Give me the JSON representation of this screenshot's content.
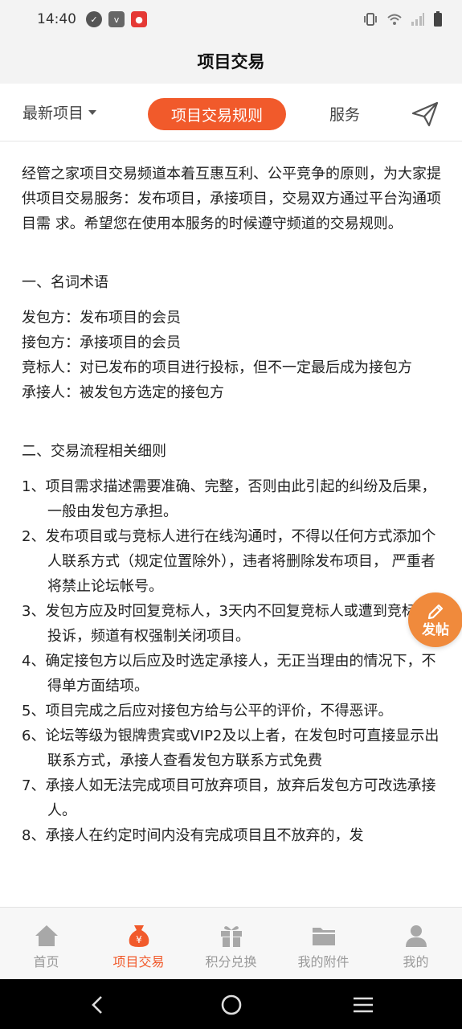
{
  "status_bar": {
    "time": "14:40",
    "left_icons": [
      "check-icon",
      "vivo-icon",
      "app-icon"
    ],
    "right_icons": [
      "vibrate-icon",
      "wifi-icon",
      "signal-icon",
      "battery-icon"
    ]
  },
  "header": {
    "title": "项目交易"
  },
  "tabs": {
    "latest": "最新项目",
    "rules": "项目交易规则",
    "service": "服务"
  },
  "content": {
    "intro": "经管之家项目交易频道本着互惠互利、公平竞争的原则，为大家提供项目交易服务：发布项目，承接项目，交易双方通过平台沟通项目需 求。希望您在使用本服务的时候遵守频道的交易规则。",
    "section1_title": "一、名词术语",
    "terms": [
      "发包方：发布项目的会员",
      "接包方：承接项目的会员",
      "竞标人：对已发布的项目进行投标，但不一定最后成为接包方",
      "承接人：被发包方选定的接包方"
    ],
    "section2_title": "二、交易流程相关细则",
    "rules": [
      "1、项目需求描述需要准确、完整，否则由此引起的纠纷及后果，一般由发包方承担。",
      "2、发布项目或与竞标人进行在线沟通时，不得以任何方式添加个人联系方式（规定位置除外），违者将删除发布项目， 严重者将禁止论坛帐号。",
      "3、发包方应及时回复竞标人，3天内不回复竞标人或遭到竞标人投诉，频道有权强制关闭项目。",
      "4、确定接包方以后应及时选定承接人，无正当理由的情况下，不得单方面结项。",
      "5、项目完成之后应对接包方给与公平的评价，不得恶评。",
      "6、论坛等级为银牌贵宾或VIP2及以上者，在发包时可直接显示出联系方式，承接人查看发包方联系方式免费",
      "7、承接人如无法完成项目可放弃项目，放弃后发包方可改选承接人。",
      "8、承接人在约定时间内没有完成项目且不放弃的，发"
    ]
  },
  "fab": {
    "label": "发帖"
  },
  "bottom_nav": {
    "items": [
      {
        "label": "首页",
        "icon": "home-icon"
      },
      {
        "label": "项目交易",
        "icon": "money-bag-icon"
      },
      {
        "label": "积分兑换",
        "icon": "gift-icon"
      },
      {
        "label": "我的附件",
        "icon": "folder-icon"
      },
      {
        "label": "我的",
        "icon": "person-icon"
      }
    ],
    "active_color": "#f15a2b",
    "inactive_color": "#9a9a9a"
  },
  "colors": {
    "accent": "#f15a2b",
    "fab": "#f08a3c"
  }
}
